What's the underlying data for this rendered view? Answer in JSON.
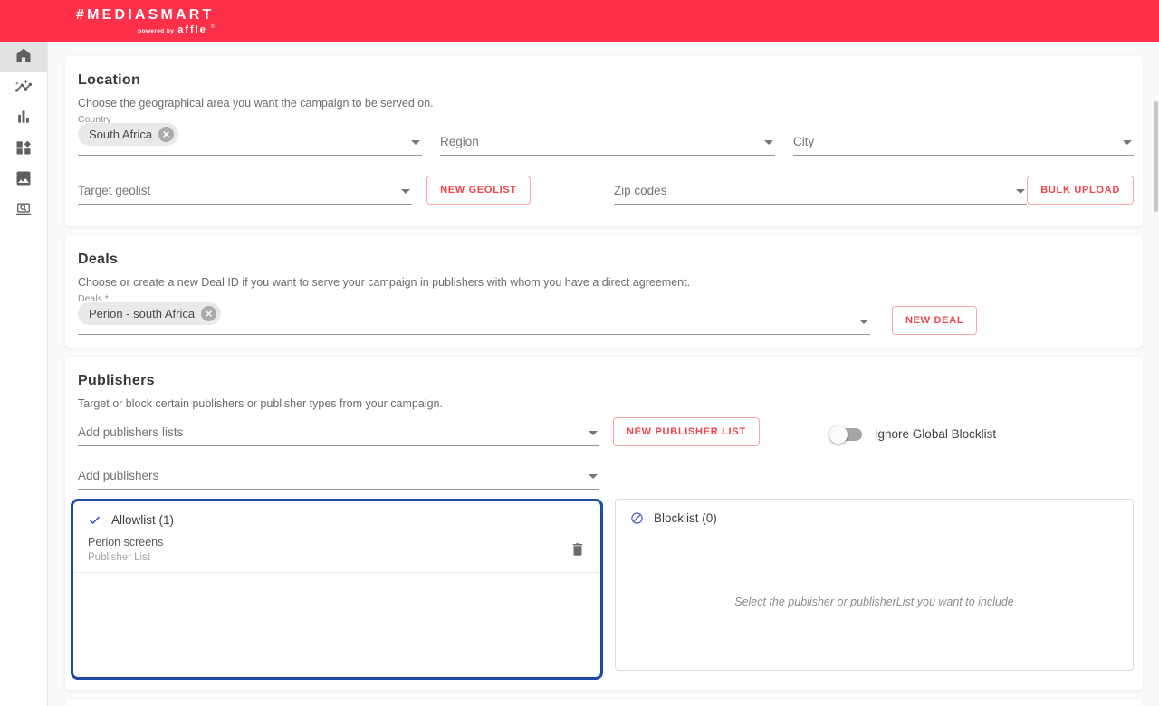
{
  "header": {
    "brand": "#MEDIASMART",
    "powered_by": "powered by",
    "affle": "affle",
    "reg": "®"
  },
  "sidebar": {
    "items": [
      {
        "icon": "home-icon",
        "active": true
      },
      {
        "icon": "insights-chart-icon",
        "active": false
      },
      {
        "icon": "bar-chart-icon",
        "active": false
      },
      {
        "icon": "dashboard-icon",
        "active": false
      },
      {
        "icon": "image-icon",
        "active": false
      },
      {
        "icon": "screen-search-icon",
        "active": false
      }
    ]
  },
  "location": {
    "title": "Location",
    "subtitle": "Choose the geographical area you want the campaign to be served on.",
    "country_label": "Country",
    "country_chip": "South Africa",
    "region_placeholder": "Region",
    "city_placeholder": "City",
    "target_geolist_placeholder": "Target geolist",
    "new_geolist_button": "NEW GEOLIST",
    "zip_codes_placeholder": "Zip codes",
    "bulk_upload_button": "BULK UPLOAD"
  },
  "deals": {
    "title": "Deals",
    "subtitle": "Choose or create a new Deal ID if you want to serve your campaign in publishers with whom you have a direct agreement.",
    "deals_label": "Deals *",
    "deal_chip": "Perion - south Africa",
    "new_deal_button": "NEW DEAL"
  },
  "publishers": {
    "title": "Publishers",
    "subtitle": "Target or block certain publishers or publisher types from your campaign.",
    "add_lists_placeholder": "Add publishers lists",
    "new_publisher_list_button": "NEW PUBLISHER LIST",
    "ignore_blocklist_label": "Ignore Global Blocklist",
    "ignore_blocklist_state": "off",
    "add_publishers_placeholder": "Add publishers",
    "allowlist": {
      "header": "Allowlist (1)",
      "items": [
        {
          "name": "Perion screens",
          "type": "Publisher List"
        }
      ]
    },
    "blocklist": {
      "header": "Blocklist (0)",
      "empty_text": "Select the publisher or publisherList you want to include"
    }
  },
  "colors": {
    "brand_red": "#FC3049",
    "accent_red": "#F4434B",
    "allowlist_border_blue": "#1B4BA3",
    "icon_blue": "#3C50C4",
    "main_background": "#FAFAFA"
  }
}
